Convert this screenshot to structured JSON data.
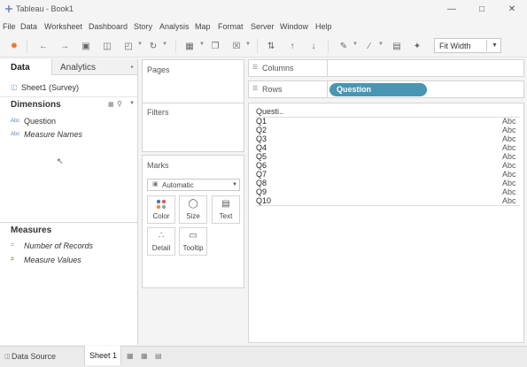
{
  "window": {
    "title": "Tableau - Book1"
  },
  "menu": [
    "File",
    "Data",
    "Worksheet",
    "Dashboard",
    "Story",
    "Analysis",
    "Map",
    "Format",
    "Server",
    "Window",
    "Help"
  ],
  "toolbar": {
    "fit": "Fit Width"
  },
  "left": {
    "tabs": [
      "Data",
      "Analytics"
    ],
    "datasource": "Sheet1 (Survey)",
    "dimensions_title": "Dimensions",
    "dimensions": [
      "Question",
      "Measure Names"
    ],
    "measures_title": "Measures",
    "measures": [
      "Number of Records",
      "Measure Values"
    ]
  },
  "pages": {
    "title": "Pages"
  },
  "filters": {
    "title": "Filters"
  },
  "marks": {
    "title": "Marks",
    "type": "Automatic",
    "buttons": [
      "Color",
      "Size",
      "Text",
      "Detail",
      "Tooltip"
    ]
  },
  "shelves": {
    "columns": "Columns",
    "rows": "Rows",
    "rows_pill": "Question"
  },
  "view": {
    "header": "Questi..",
    "rows": [
      "Q1",
      "Q2",
      "Q3",
      "Q4",
      "Q5",
      "Q6",
      "Q7",
      "Q8",
      "Q9",
      "Q10"
    ],
    "cell": "Abc"
  },
  "bottom": {
    "datasource": "Data Source",
    "sheet": "Sheet 1"
  },
  "colors": {
    "pill": "#4996b2",
    "accent": "#e8762d"
  }
}
